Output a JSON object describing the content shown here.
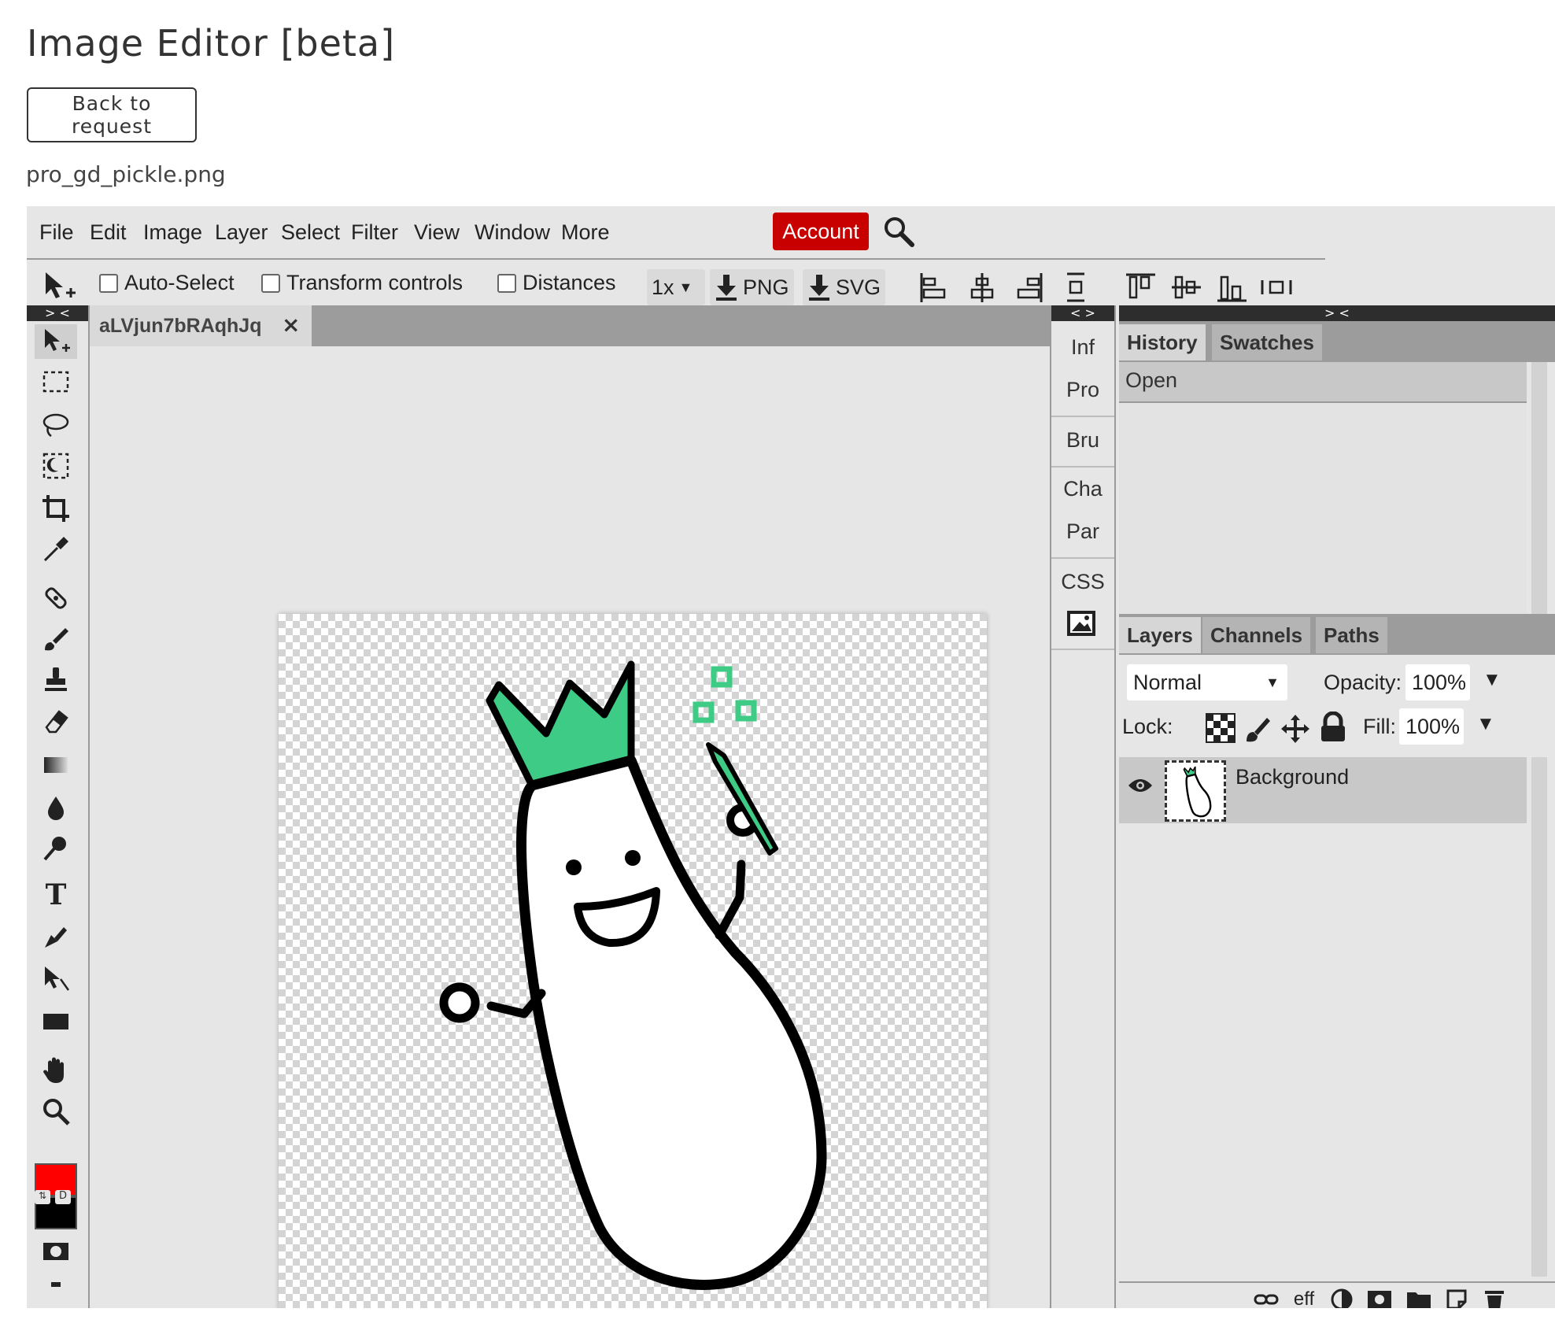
{
  "page": {
    "title": "Image Editor [beta]",
    "back_label": "Back to request",
    "filename": "pro_gd_pickle.png"
  },
  "menu": {
    "items": [
      "File",
      "Edit",
      "Image",
      "Layer",
      "Select",
      "Filter",
      "View",
      "Window",
      "More"
    ],
    "account_label": "Account",
    "account_color": "#c80000"
  },
  "options": {
    "auto_select": "Auto-Select",
    "transform_controls": "Transform controls",
    "distances": "Distances",
    "zoom": "1x",
    "png_label": "PNG",
    "svg_label": "SVG"
  },
  "panel_toggle": "> <",
  "mini_toggle": "< >",
  "document": {
    "tab_label": "aLVjun7bRAqhJq",
    "close_glyph": "×"
  },
  "mini_panel": [
    "Inf",
    "Pro",
    "Bru",
    "Cha",
    "Par",
    "CSS"
  ],
  "history": {
    "tabs": [
      "History",
      "Swatches"
    ],
    "rows": [
      "Open"
    ]
  },
  "layers": {
    "tabs": [
      "Layers",
      "Channels",
      "Paths"
    ],
    "blend_mode": "Normal",
    "opacity_label": "Opacity:",
    "opacity_value": "100%",
    "lock_label": "Lock:",
    "fill_label": "Fill:",
    "fill_value": "100%",
    "layer_name": "Background",
    "footer_eff": "eff"
  },
  "colors": {
    "foreground": "#ff0000",
    "background": "#000000",
    "crown_green": "#3ecb86"
  }
}
